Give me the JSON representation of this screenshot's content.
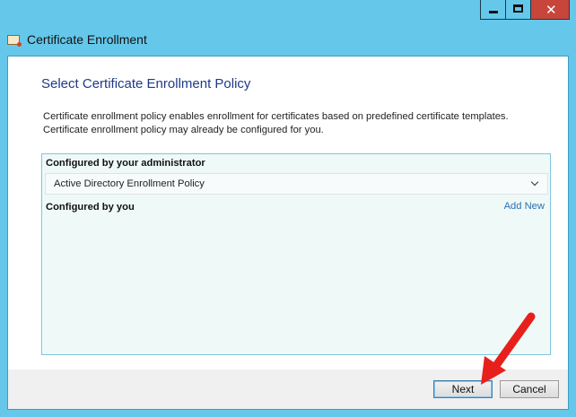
{
  "window": {
    "title": "Certificate Enrollment",
    "controls": {
      "minimize": "minimize",
      "maximize": "maximize",
      "close": "✕"
    }
  },
  "page": {
    "heading": "Select Certificate Enrollment Policy",
    "description_line1": "Certificate enrollment policy enables enrollment for certificates based on predefined certificate templates.",
    "description_line2": "Certificate enrollment policy may already be configured for you."
  },
  "policy_panel": {
    "admin_section_label": "Configured by your administrator",
    "admin_policy": "Active Directory Enrollment Policy",
    "user_section_label": "Configured by you",
    "add_new_link": "Add New"
  },
  "footer": {
    "next_label": "Next",
    "cancel_label": "Cancel"
  },
  "annotation": {
    "arrow_color": "#e8201c",
    "points_to": "next-button"
  },
  "colors": {
    "window_frame": "#65c8eb",
    "heading": "#1e3a8a",
    "link": "#2a6fb2",
    "close_button": "#c7453a"
  }
}
